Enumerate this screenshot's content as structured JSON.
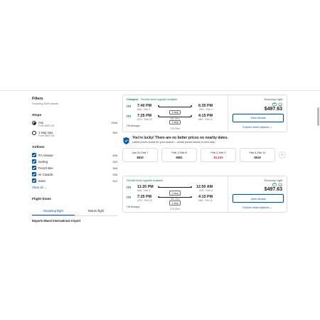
{
  "filters": {
    "title": "Filters",
    "showing": "Showing 1545 results",
    "stops": {
      "heading": "Stops",
      "options": [
        {
          "label": "Any",
          "sub": "From $497.63",
          "count": "1545",
          "selected": true
        },
        {
          "label": "1 stop max",
          "sub": "From $497.63",
          "count": "360",
          "selected": false
        }
      ]
    },
    "airlines": {
      "heading": "Airlines",
      "items": [
        {
          "label": "ITA Airways",
          "count": "458"
        },
        {
          "label": "Vueling",
          "count": "393"
        },
        {
          "label": "French Bee",
          "count": "365"
        },
        {
          "label": "Air Canada",
          "count": "335"
        },
        {
          "label": "Swiss",
          "count": "313"
        }
      ],
      "show_all": "Show all"
    },
    "flight_times": {
      "heading": "Flight times",
      "tabs": [
        "Departing flight",
        "Return flight"
      ],
      "departs": "Departs Miami International Airport"
    }
  },
  "results": [
    {
      "badges": [
        "Cheapest",
        "Flexible ticket upgrade available"
      ],
      "flights": [
        {
          "dep_time": "7:40 PM",
          "dep_ap": "MIA · Feb 3",
          "stops": "1 stop",
          "duration": "15h 55m",
          "arr_time": "6:35 PM",
          "arr_ap": "ATH · Feb 4"
        },
        {
          "dep_time": "7:25 PM",
          "dep_ap": "ATH · Feb 10",
          "stops": "1 stop",
          "duration": "27h 50m",
          "arr_time": "4:15 PM",
          "arr_ap": "MIA · Feb 11"
        }
      ],
      "carrier": "ITA Airways",
      "fare": "Economy Light",
      "price": "$497.63",
      "view": "View details",
      "explore": "Explore ticket options"
    },
    {
      "badges": [
        "Flexible ticket upgrade available"
      ],
      "flights": [
        {
          "dep_time": "11:20 PM",
          "dep_ap": "MIA · Feb 3",
          "stops": "1 stop",
          "duration": "18h 30m",
          "arr_time": "12:50 AM",
          "arr_ap": "ATH · Feb 5"
        },
        {
          "dep_time": "7:25 PM",
          "dep_ap": "ATH · Feb 10",
          "stops": "1 stop",
          "duration": "27h 50m",
          "arr_time": "4:15 PM",
          "arr_ap": "MIA · Feb 11"
        }
      ],
      "carrier": "ITA Airways",
      "fare": "Economy Light",
      "price": "$497.63",
      "view": "View details",
      "explore": "Explore ticket options"
    }
  ],
  "lucky": {
    "title": "You're lucky! There are no better prices on nearby dates.",
    "sub": "Latest prices found for your search – actual prices shown in next step",
    "dates": [
      {
        "date": "Jan 31-Feb 7",
        "price": "$810",
        "highlight": false
      },
      {
        "date": "Feb 1-Feb 8",
        "price": "$581",
        "highlight": false
      },
      {
        "date": "Feb 2-Feb 9",
        "price": "$1,103",
        "highlight": true
      },
      {
        "date": "Feb 4-Feb 11",
        "price": "$516",
        "highlight": false
      }
    ]
  },
  "colors": {
    "accent": "#0158a6",
    "green": "#0a7f3a",
    "red": "#d1242f"
  }
}
